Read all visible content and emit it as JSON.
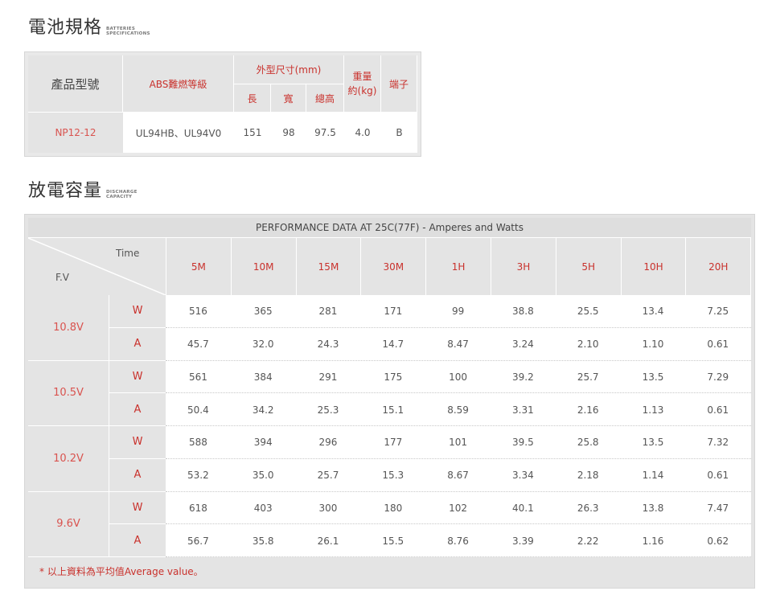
{
  "spec_section": {
    "title": "電池規格",
    "subtitle_line1": "BATTERIES",
    "subtitle_line2": "SPECIFICATIONS"
  },
  "spec_table": {
    "headers": {
      "model": "產品型號",
      "abs": "ABS難燃等級",
      "dimensions": "外型尺寸(mm)",
      "length": "長",
      "width": "寬",
      "height": "總高",
      "weight_line1": "重量",
      "weight_line2": "約(kg)",
      "terminal": "端子"
    },
    "row": {
      "model": "NP12-12",
      "abs": "UL94HB、UL94V0",
      "length": "151",
      "width": "98",
      "height": "97.5",
      "weight": "4.0",
      "terminal": "B"
    }
  },
  "discharge_section": {
    "title": "放電容量",
    "subtitle_line1": "DISCHARGE",
    "subtitle_line2": "CAPACITY"
  },
  "discharge_table": {
    "caption": "PERFORMANCE DATA AT 25C(77F) - Amperes and Watts",
    "corner_time": "Time",
    "corner_fv": "F.V",
    "times": [
      "5M",
      "10M",
      "15M",
      "30M",
      "1H",
      "3H",
      "5H",
      "10H",
      "20H"
    ],
    "groups": [
      {
        "voltage": "10.8V",
        "rows": [
          {
            "unit": "W",
            "values": [
              "516",
              "365",
              "281",
              "171",
              "99",
              "38.8",
              "25.5",
              "13.4",
              "7.25"
            ]
          },
          {
            "unit": "A",
            "values": [
              "45.7",
              "32.0",
              "24.3",
              "14.7",
              "8.47",
              "3.24",
              "2.10",
              "1.10",
              "0.61"
            ]
          }
        ]
      },
      {
        "voltage": "10.5V",
        "rows": [
          {
            "unit": "W",
            "values": [
              "561",
              "384",
              "291",
              "175",
              "100",
              "39.2",
              "25.7",
              "13.5",
              "7.29"
            ]
          },
          {
            "unit": "A",
            "values": [
              "50.4",
              "34.2",
              "25.3",
              "15.1",
              "8.59",
              "3.31",
              "2.16",
              "1.13",
              "0.61"
            ]
          }
        ]
      },
      {
        "voltage": "10.2V",
        "rows": [
          {
            "unit": "W",
            "values": [
              "588",
              "394",
              "296",
              "177",
              "101",
              "39.5",
              "25.8",
              "13.5",
              "7.32"
            ]
          },
          {
            "unit": "A",
            "values": [
              "53.2",
              "35.0",
              "25.7",
              "15.3",
              "8.67",
              "3.34",
              "2.18",
              "1.14",
              "0.61"
            ]
          }
        ]
      },
      {
        "voltage": "9.6V",
        "rows": [
          {
            "unit": "W",
            "values": [
              "618",
              "403",
              "300",
              "180",
              "102",
              "40.1",
              "26.3",
              "13.8",
              "7.47"
            ]
          },
          {
            "unit": "A",
            "values": [
              "56.7",
              "35.8",
              "26.1",
              "15.5",
              "8.76",
              "3.39",
              "2.22",
              "1.16",
              "0.62"
            ]
          }
        ]
      }
    ],
    "footnote": "* 以上資料為平均值Average value。"
  }
}
